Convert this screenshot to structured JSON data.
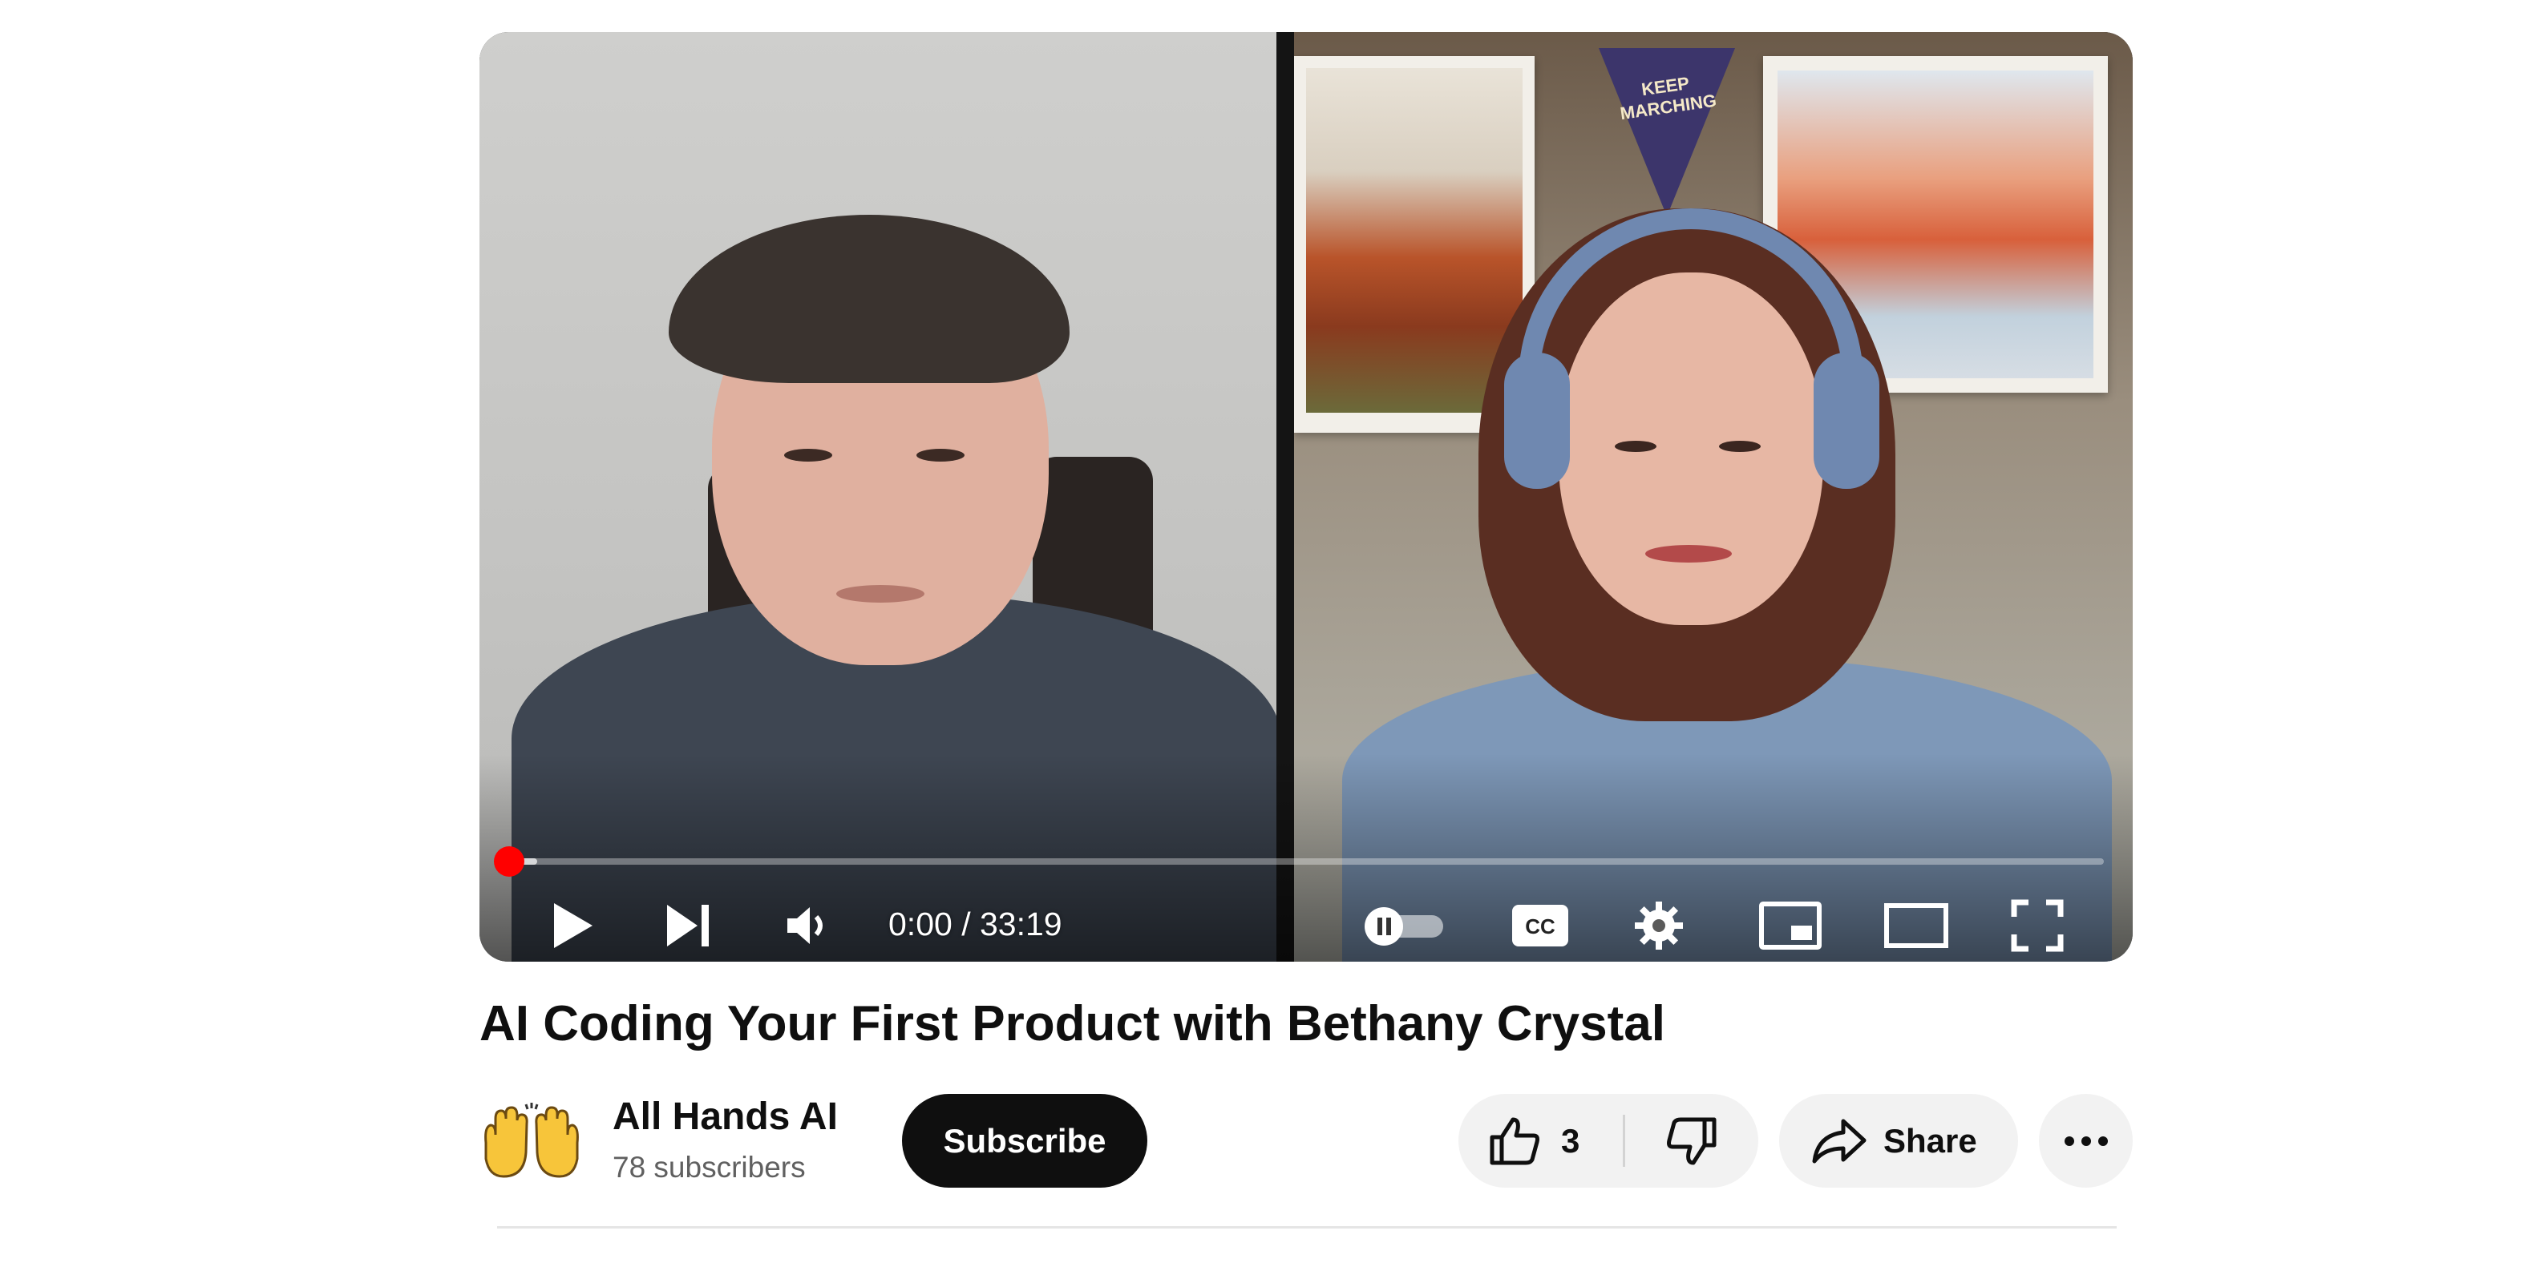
{
  "player": {
    "time_display": "0:00 / 33:19",
    "progress_fraction": 0.0,
    "pennant_text": "KEEP MARCHING",
    "controls": {
      "play": "play-icon",
      "next": "next-icon",
      "volume": "volume-icon",
      "autoplay": "autoplay-toggle-icon",
      "captions": "cc-icon",
      "settings": "gear-icon",
      "miniplayer": "miniplayer-icon",
      "theater": "theater-icon",
      "fullscreen": "fullscreen-icon"
    },
    "accent_color": "#ff0000"
  },
  "video": {
    "title": "AI Coding Your First Product with Bethany Crystal"
  },
  "channel": {
    "name": "All Hands AI",
    "subscribers": "78 subscribers",
    "avatar_icon": "raised-hands-icon"
  },
  "actions": {
    "subscribe_label": "Subscribe",
    "like_count": "3",
    "share_label": "Share",
    "like_icon": "thumbs-up-icon",
    "dislike_icon": "thumbs-down-icon",
    "share_icon": "share-arrow-icon",
    "more_icon": "more-horizontal-icon"
  }
}
